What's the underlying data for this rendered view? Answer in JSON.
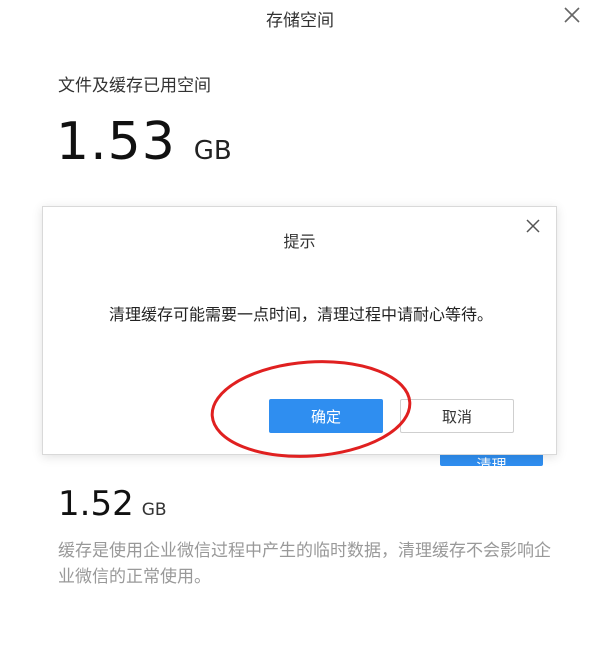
{
  "window": {
    "title": "存储空间"
  },
  "storage": {
    "label": "文件及缓存已用空间",
    "used_value": "1.53",
    "used_unit": "GB"
  },
  "cache": {
    "clear_button_label": "清理",
    "value": "1.52",
    "unit": "GB",
    "description": "缓存是使用企业微信过程中产生的临时数据，清理缓存不会影响企业微信的正常使用。"
  },
  "dialog": {
    "title": "提示",
    "message": "清理缓存可能需要一点时间，清理过程中请耐心等待。",
    "confirm_label": "确定",
    "cancel_label": "取消"
  },
  "colors": {
    "primary": "#2f8ef0",
    "annotation": "#e02020"
  },
  "icons": {
    "window_close": "close-icon",
    "dialog_close": "close-icon"
  }
}
